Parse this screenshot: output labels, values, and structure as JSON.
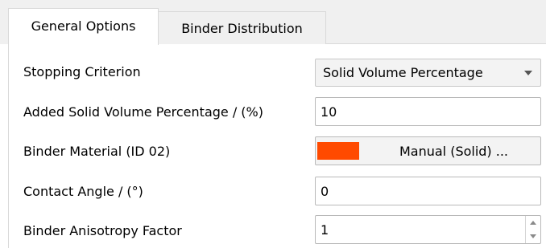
{
  "tabs": [
    {
      "label": "General Options",
      "active": true
    },
    {
      "label": "Binder Distribution",
      "active": false
    }
  ],
  "options": {
    "stopping_criterion": {
      "label": "Stopping Criterion",
      "selected": "Solid Volume Percentage"
    },
    "added_solid_volume": {
      "label": "Added Solid Volume Percentage / (%)",
      "value": "10"
    },
    "binder_material": {
      "label": "Binder Material (ID 02)",
      "button_text": "Manual (Solid) ...",
      "color": "#ff4a00"
    },
    "contact_angle": {
      "label": "Contact Angle / (°)",
      "value": "0"
    },
    "binder_anisotropy": {
      "label": "Binder Anisotropy Factor",
      "value": "1"
    }
  },
  "icons": {
    "dropdown": "chevron-down-icon",
    "spin_up": "arrow-up-icon",
    "spin_down": "arrow-down-icon"
  }
}
